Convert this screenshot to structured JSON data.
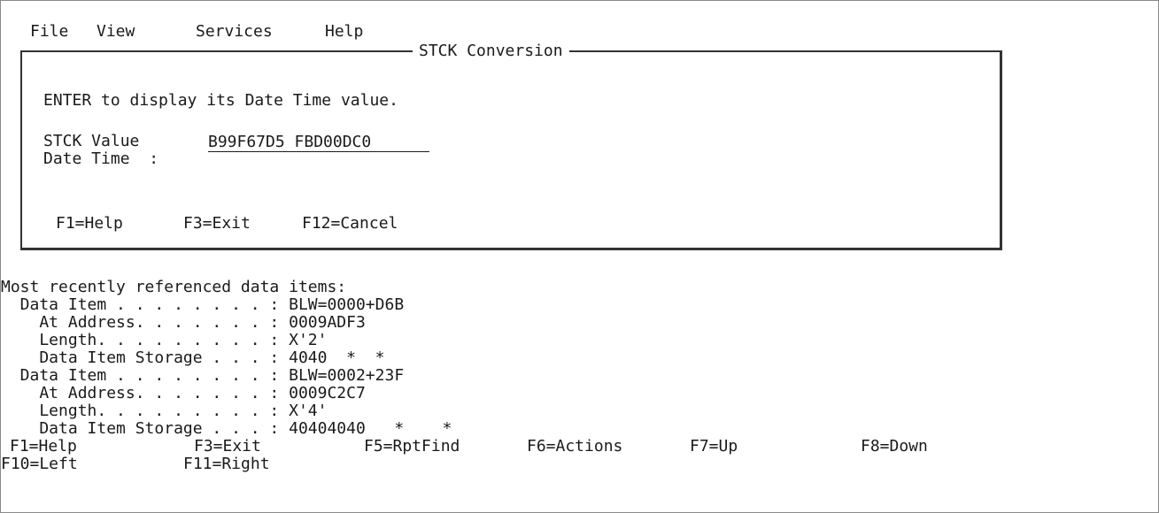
{
  "menu": {
    "items": [
      "File",
      "View",
      "Services",
      "Help"
    ]
  },
  "popup": {
    "title": "STCK Conversion",
    "instruction": "ENTER to display its Date Time value.",
    "stck_label": "STCK Value",
    "stck_value": "B99F67D5 FBD00DC0",
    "datetime_label": "Date Time  :",
    "datetime_value": "",
    "fkeys": [
      "F1=Help",
      "F3=Exit",
      "F12=Cancel"
    ]
  },
  "recent": {
    "heading": "Most recently referenced data items:",
    "lines": [
      "  Data Item . . . . . . . . : BLW=0000+D6B",
      "    At Address. . . . . . . : 0009ADF3",
      "    Length. . . . . . . . . : X'2'",
      "    Data Item Storage . . . : 4040  *  *",
      "  Data Item . . . . . . . . : BLW=0002+23F",
      "    At Address. . . . . . . : 0009C2C7",
      "    Length. . . . . . . . . : X'4'",
      "    Data Item Storage . . . : 40404040   *    *"
    ]
  },
  "footer": {
    "row1": [
      "F1=Help",
      "F3=Exit",
      "F5=RptFind",
      "F6=Actions",
      "F7=Up",
      "F8=Down"
    ],
    "row2": [
      "F10=Left",
      "F11=Right"
    ]
  }
}
